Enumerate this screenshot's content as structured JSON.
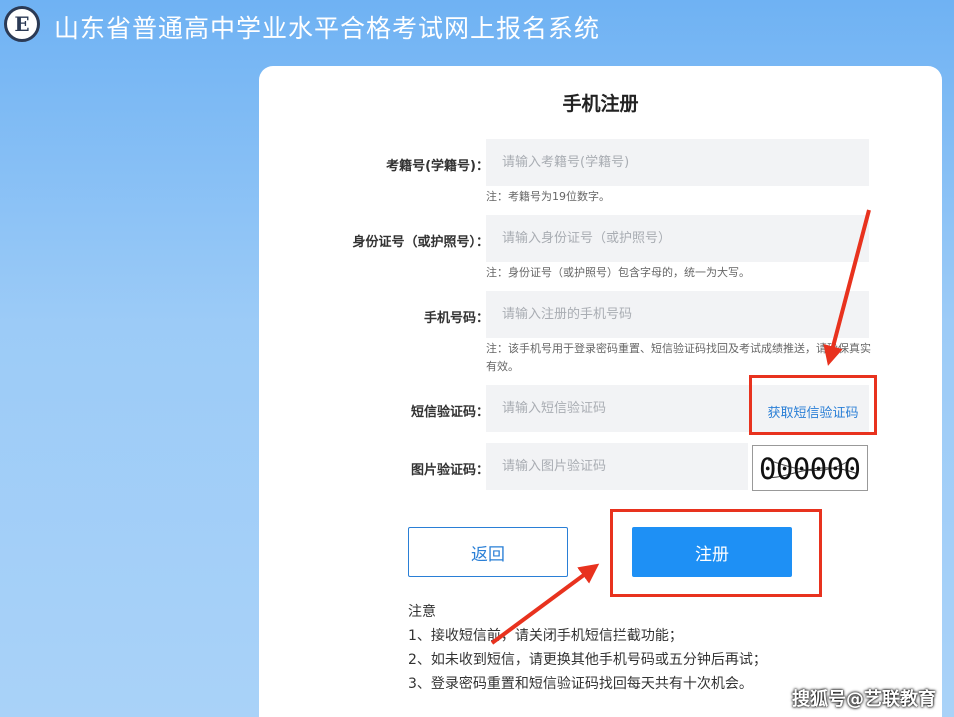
{
  "header": {
    "logo_letter": "E",
    "title": "山东省普通高中学业水平合格考试网上报名系统"
  },
  "form": {
    "title": "手机注册",
    "exam_id": {
      "label": "考籍号(学籍号)：",
      "placeholder": "请输入考籍号(学籍号)",
      "note": "注：考籍号为19位数字。"
    },
    "id_card": {
      "label": "身份证号（或护照号）：",
      "placeholder": "请输入身份证号（或护照号）",
      "note": "注：身份证号（或护照号）包含字母的，统一为大写。"
    },
    "phone": {
      "label": "手机号码：",
      "placeholder": "请输入注册的手机号码",
      "note": "注：该手机号用于登录密码重置、短信验证码找回及考试成绩推送，请确保真实有效。"
    },
    "sms_code": {
      "label": "短信验证码：",
      "placeholder": "请输入短信验证码",
      "get_code": "获取短信验证码"
    },
    "image_code": {
      "label": "图片验证码：",
      "placeholder": "请输入图片验证码",
      "captcha_text": "000000"
    },
    "back_button": "返回",
    "register_button": "注册"
  },
  "notice": {
    "heading": "注意",
    "items": [
      "1、接收短信前，请关闭手机短信拦截功能；",
      "2、如未收到短信，请更换其他手机号码或五分钟后再试；",
      "3、登录密码重置和短信验证码找回每天共有十次机会。"
    ]
  },
  "watermark": "搜狐号@艺联教育",
  "colors": {
    "primary": "#1e90f5",
    "annotation": "#e8321e"
  }
}
